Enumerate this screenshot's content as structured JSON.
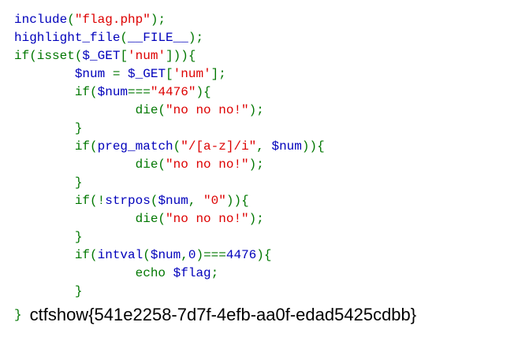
{
  "colors": {
    "default": "#0000BB",
    "keyword": "#007700",
    "string": "#DD0000",
    "output": "#000000"
  },
  "code_lines": [
    [
      {
        "t": "default",
        "v": "include"
      },
      {
        "t": "keyword",
        "v": "("
      },
      {
        "t": "string",
        "v": "\"flag.php\""
      },
      {
        "t": "keyword",
        "v": ");"
      }
    ],
    [
      {
        "t": "default",
        "v": "highlight_file"
      },
      {
        "t": "keyword",
        "v": "("
      },
      {
        "t": "default",
        "v": "__FILE__"
      },
      {
        "t": "keyword",
        "v": ");"
      }
    ],
    [
      {
        "t": "keyword",
        "v": "if(isset("
      },
      {
        "t": "default",
        "v": "$_GET"
      },
      {
        "t": "keyword",
        "v": "["
      },
      {
        "t": "string",
        "v": "'num'"
      },
      {
        "t": "keyword",
        "v": "])){"
      }
    ],
    [
      {
        "t": "keyword",
        "v": "        "
      },
      {
        "t": "default",
        "v": "$num "
      },
      {
        "t": "keyword",
        "v": "= "
      },
      {
        "t": "default",
        "v": "$_GET"
      },
      {
        "t": "keyword",
        "v": "["
      },
      {
        "t": "string",
        "v": "'num'"
      },
      {
        "t": "keyword",
        "v": "];"
      }
    ],
    [
      {
        "t": "keyword",
        "v": "        if("
      },
      {
        "t": "default",
        "v": "$num"
      },
      {
        "t": "keyword",
        "v": "==="
      },
      {
        "t": "string",
        "v": "\"4476\""
      },
      {
        "t": "keyword",
        "v": "){"
      }
    ],
    [
      {
        "t": "keyword",
        "v": "                die("
      },
      {
        "t": "string",
        "v": "\"no no no!\""
      },
      {
        "t": "keyword",
        "v": ");"
      }
    ],
    [
      {
        "t": "keyword",
        "v": "        }"
      }
    ],
    [
      {
        "t": "keyword",
        "v": "        if("
      },
      {
        "t": "default",
        "v": "preg_match"
      },
      {
        "t": "keyword",
        "v": "("
      },
      {
        "t": "string",
        "v": "\"/[a-z]/i\""
      },
      {
        "t": "keyword",
        "v": ", "
      },
      {
        "t": "default",
        "v": "$num"
      },
      {
        "t": "keyword",
        "v": ")){"
      }
    ],
    [
      {
        "t": "keyword",
        "v": "                die("
      },
      {
        "t": "string",
        "v": "\"no no no!\""
      },
      {
        "t": "keyword",
        "v": ");"
      }
    ],
    [
      {
        "t": "keyword",
        "v": "        }"
      }
    ],
    [
      {
        "t": "keyword",
        "v": "        if(!"
      },
      {
        "t": "default",
        "v": "strpos"
      },
      {
        "t": "keyword",
        "v": "("
      },
      {
        "t": "default",
        "v": "$num"
      },
      {
        "t": "keyword",
        "v": ", "
      },
      {
        "t": "string",
        "v": "\"0\""
      },
      {
        "t": "keyword",
        "v": ")){"
      }
    ],
    [
      {
        "t": "keyword",
        "v": "                die("
      },
      {
        "t": "string",
        "v": "\"no no no!\""
      },
      {
        "t": "keyword",
        "v": ");"
      }
    ],
    [
      {
        "t": "keyword",
        "v": "        }"
      }
    ],
    [
      {
        "t": "keyword",
        "v": "        if("
      },
      {
        "t": "default",
        "v": "intval"
      },
      {
        "t": "keyword",
        "v": "("
      },
      {
        "t": "default",
        "v": "$num"
      },
      {
        "t": "keyword",
        "v": ","
      },
      {
        "t": "default",
        "v": "0"
      },
      {
        "t": "keyword",
        "v": ")==="
      },
      {
        "t": "default",
        "v": "4476"
      },
      {
        "t": "keyword",
        "v": "){"
      }
    ],
    [
      {
        "t": "keyword",
        "v": "                echo "
      },
      {
        "t": "default",
        "v": "$flag"
      },
      {
        "t": "keyword",
        "v": ";"
      }
    ],
    [
      {
        "t": "keyword",
        "v": "        }"
      }
    ]
  ],
  "closing_brace": "}",
  "flag_output": "ctfshow{541e2258-7d7f-4efb-aa0f-edad5425cdbb}"
}
